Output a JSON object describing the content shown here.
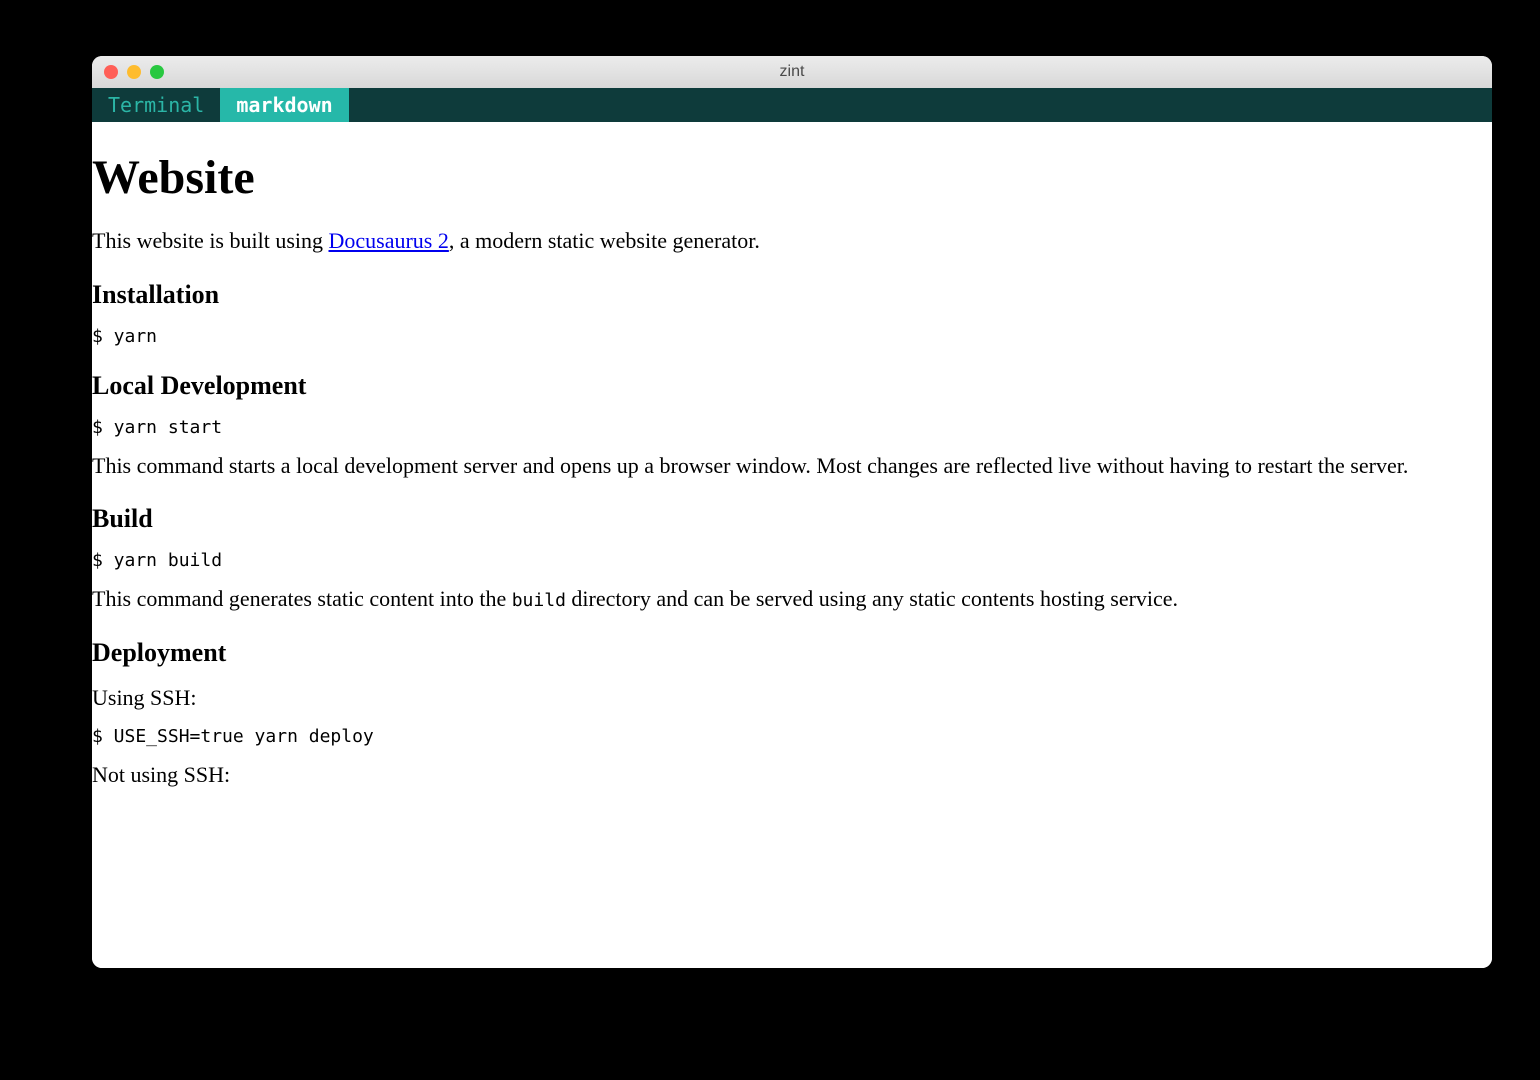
{
  "window": {
    "title": "zint"
  },
  "tabs": {
    "terminal": "Terminal",
    "markdown": "markdown"
  },
  "doc": {
    "h1": "Website",
    "intro_pre": "This website is built using ",
    "intro_link": "Docusaurus 2",
    "intro_post": ", a modern static website generator.",
    "installation": {
      "heading": "Installation",
      "code": "$ yarn"
    },
    "localdev": {
      "heading": "Local Development",
      "code": "$ yarn start",
      "desc": "This command starts a local development server and opens up a browser window. Most changes are reflected live without having to restart the server."
    },
    "build": {
      "heading": "Build",
      "code": "$ yarn build",
      "desc_pre": "This command generates static content into the ",
      "desc_code": "build",
      "desc_post": " directory and can be served using any static contents hosting service."
    },
    "deployment": {
      "heading": "Deployment",
      "using_ssh_label": "Using SSH:",
      "using_ssh_code": "$ USE_SSH=true yarn deploy",
      "not_using_ssh_label": "Not using SSH:"
    }
  }
}
